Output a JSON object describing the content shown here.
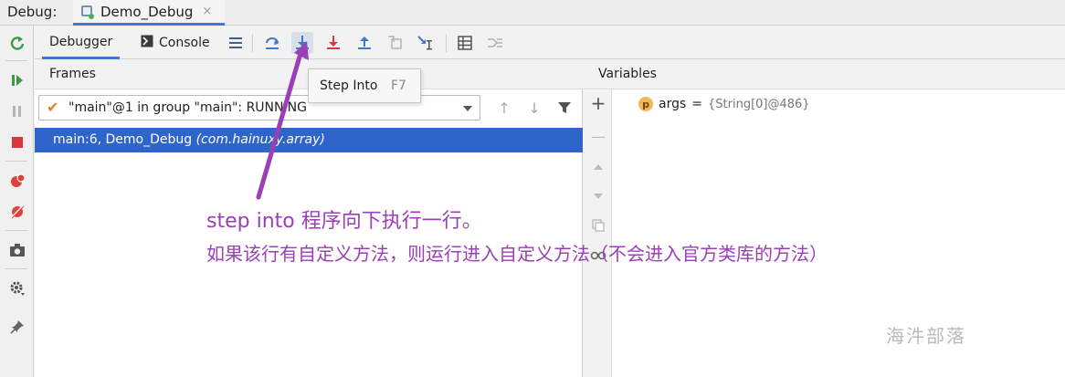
{
  "titlebar": {
    "debug_label": "Debug:",
    "run_tab": "Demo_Debug",
    "close_glyph": "×"
  },
  "toolbar": {
    "debugger_tab": "Debugger",
    "console_tab": "Console",
    "buttons": [
      "menu-icon",
      "show-execution-point-icon",
      "step-into-icon",
      "force-step-into-icon",
      "step-out-icon",
      "drop-frame-icon",
      "run-to-cursor-icon",
      "evaluate-expression-icon",
      "trace-current-stream-icon"
    ]
  },
  "tooltip": {
    "label": "Step Into",
    "shortcut": "F7"
  },
  "frames": {
    "header": "Frames",
    "thread_selector": "\"main\"@1 in group \"main\": RUNNING",
    "selected_frame": {
      "method": "main:6, Demo_Debug",
      "package": "(com.hainuxy.array)"
    }
  },
  "variables": {
    "header": "Variables",
    "items": [
      {
        "badge": "p",
        "name": "args",
        "equals": "=",
        "value": "{String[0]@486}"
      }
    ]
  },
  "annotation": {
    "line1": "step into 程序向下执行一行。",
    "line2": "如果该行有自定义方法，则运行进入自定义方法（不会进入官方类库的方法）",
    "color": "#9b3fb5"
  },
  "watermark": "海汼部落",
  "colors": {
    "accent": "#3d7ac9",
    "selection": "#2f65ca",
    "annotation": "#9b3fb5"
  }
}
